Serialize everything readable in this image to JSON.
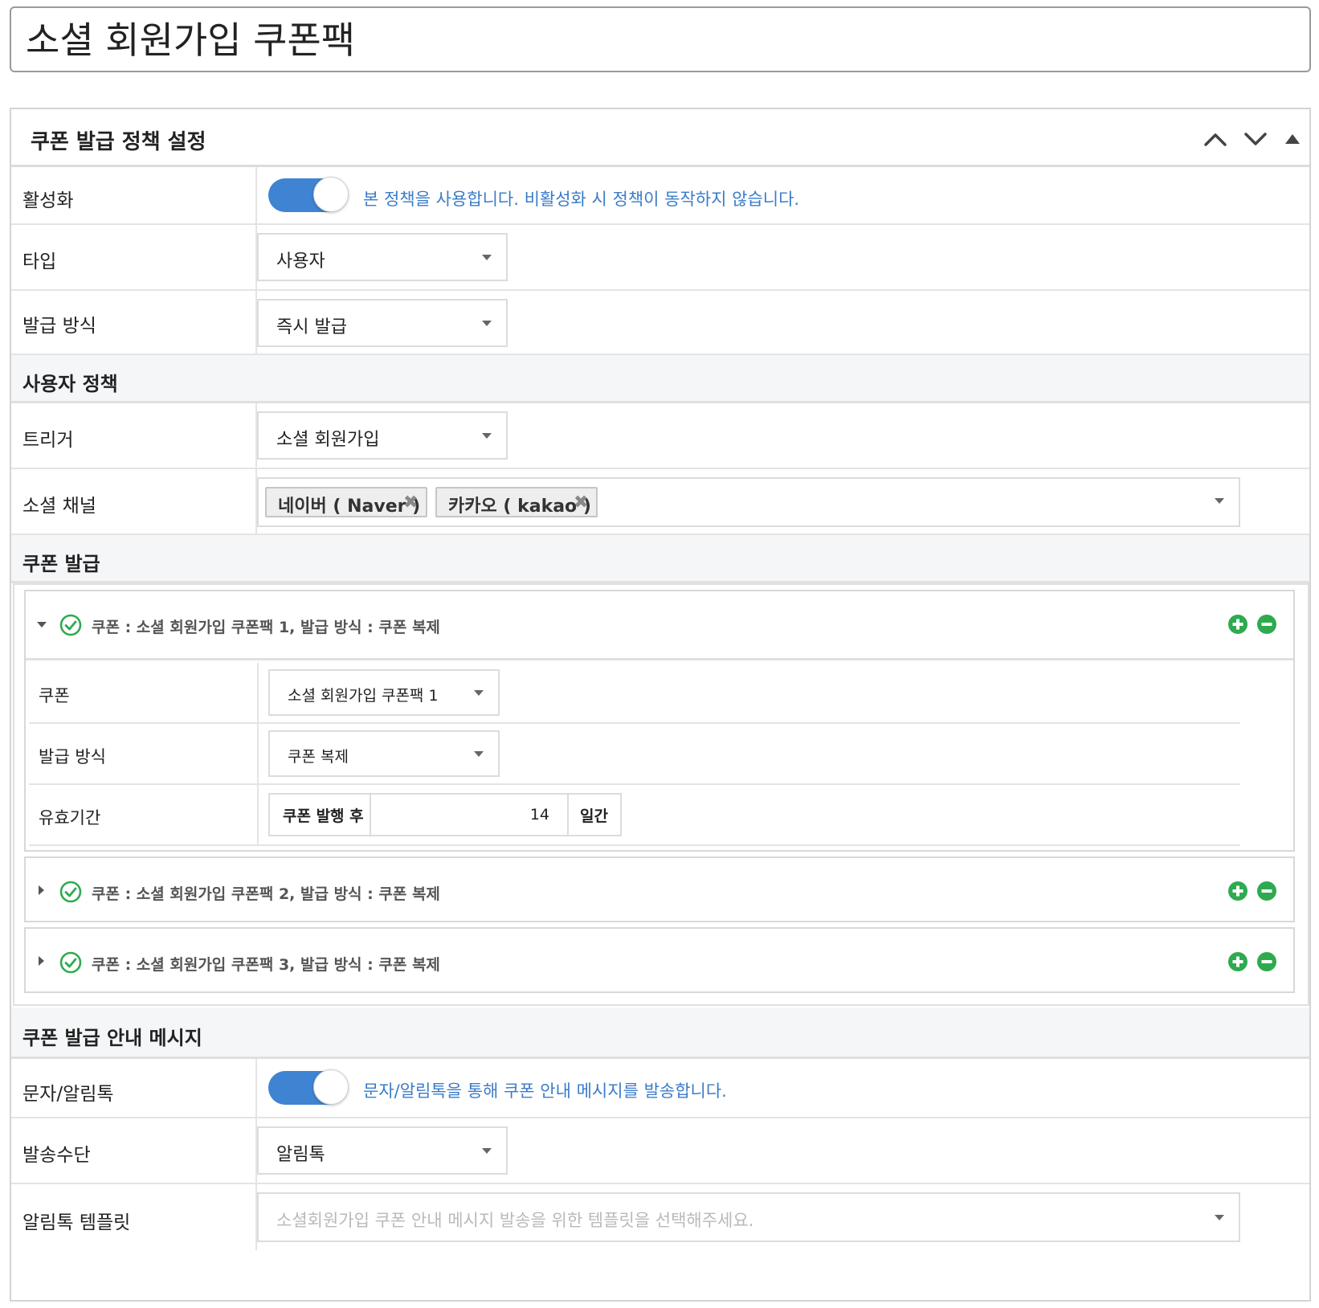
{
  "page": {
    "title": "소셜 회원가입 쿠폰팩"
  },
  "panel": {
    "title": "쿠폰 발급 정책 설정"
  },
  "rows": {
    "activation": {
      "label": "활성화",
      "description": "본 정책을 사용합니다. 비활성화 시 정책이 동작하지 않습니다."
    },
    "type": {
      "label": "타입",
      "value": "사용자"
    },
    "issue_method": {
      "label": "발급 방식",
      "value": "즉시 발급"
    }
  },
  "user_policy": {
    "title": "사용자 정책",
    "trigger": {
      "label": "트리거",
      "value": "소셜 회원가입"
    },
    "social_channel": {
      "label": "소셜 채널",
      "tags": [
        "네이버 ( Naver )",
        "카카오 ( kakao )"
      ]
    }
  },
  "coupon_issue": {
    "title": "쿠폰 발급",
    "items": [
      {
        "summary": "쿠폰 : 소셜 회원가입 쿠폰팩 1, 발급 방식 : 쿠폰 복제",
        "expanded": true
      },
      {
        "summary": "쿠폰 : 소셜 회원가입 쿠폰팩 2, 발급 방식 : 쿠폰 복제",
        "expanded": false
      },
      {
        "summary": "쿠폰 : 소셜 회원가입 쿠폰팩 3, 발급 방식 : 쿠폰 복제",
        "expanded": false
      }
    ],
    "detail": {
      "coupon": {
        "label": "쿠폰",
        "value": "소셜 회원가입 쿠폰팩 1"
      },
      "method": {
        "label": "발급 방식",
        "value": "쿠폰 복제"
      },
      "validity": {
        "label": "유효기간",
        "prefix": "쿠폰 발행 후",
        "value": "14",
        "suffix": "일간"
      }
    }
  },
  "message": {
    "title": "쿠폰 발급 안내 메시지",
    "sms": {
      "label": "문자/알림톡",
      "description": "문자/알림톡을 통해 쿠폰 안내 메시지를 발송합니다."
    },
    "channel": {
      "label": "발송수단",
      "value": "알림톡"
    },
    "template": {
      "label": "알림톡 템플릿",
      "placeholder": "소셜회원가입 쿠폰 안내 메시지 발송을 위한 템플릿을 선택해주세요."
    }
  },
  "colors": {
    "accent": "#3f83d3",
    "success": "#2eaa4f",
    "link_text": "#3a7cc9"
  },
  "icons": {
    "up": "chevron-up-icon",
    "down": "chevron-down-icon",
    "collapse": "triangle-up-icon",
    "check": "check-circle-icon",
    "add": "plus-circle-icon",
    "remove": "minus-circle-icon"
  }
}
